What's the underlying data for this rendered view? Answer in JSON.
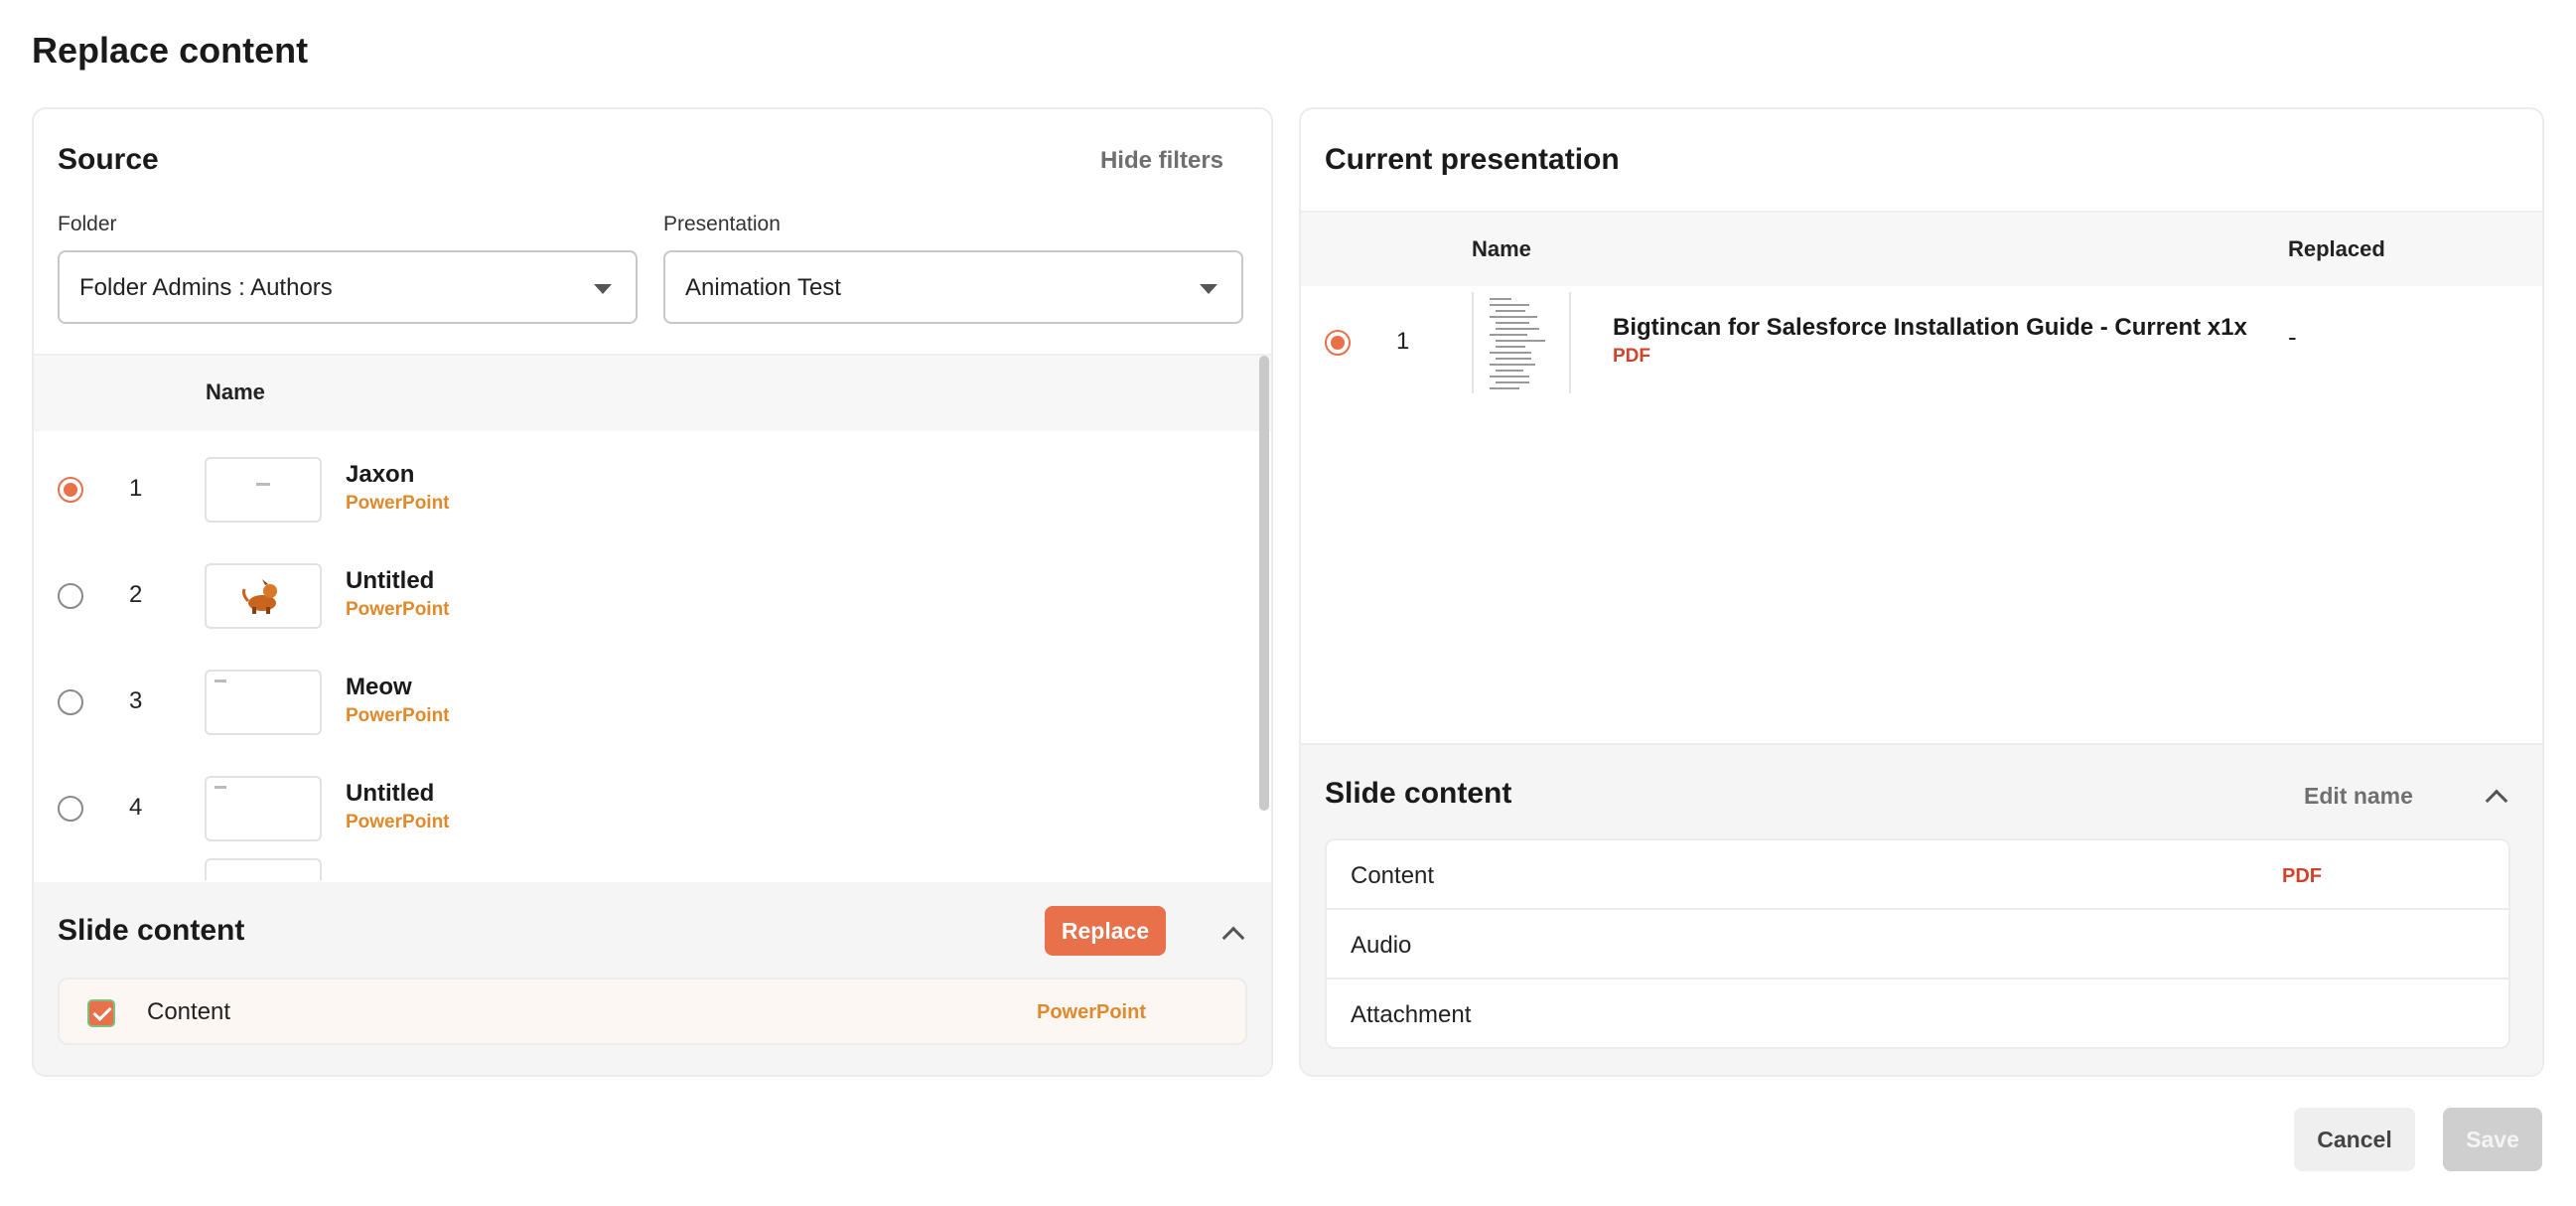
{
  "dialog": {
    "title": "Replace content"
  },
  "source": {
    "heading": "Source",
    "hide_filters_label": "Hide filters",
    "folder_label": "Folder",
    "folder_value": "Folder Admins : Authors",
    "presentation_label": "Presentation",
    "presentation_value": "Animation Test",
    "column_name": "Name",
    "items": [
      {
        "num": "1",
        "title": "Jaxon",
        "type": "PowerPoint",
        "selected": true
      },
      {
        "num": "2",
        "title": "Untitled",
        "type": "PowerPoint",
        "selected": false
      },
      {
        "num": "3",
        "title": "Meow",
        "type": "PowerPoint",
        "selected": false
      },
      {
        "num": "4",
        "title": "Untitled",
        "type": "PowerPoint",
        "selected": false
      }
    ],
    "slide_content": {
      "heading": "Slide content",
      "replace_label": "Replace",
      "content_label": "Content",
      "content_type": "PowerPoint",
      "checked": true
    }
  },
  "current": {
    "heading": "Current presentation",
    "column_name": "Name",
    "column_replaced": "Replaced",
    "row": {
      "num": "1",
      "title": "Bigtincan for Salesforce Installation Guide - Current x1x",
      "type": "PDF",
      "replaced": "-"
    },
    "slide_content": {
      "heading": "Slide content",
      "edit_name_label": "Edit name",
      "rows": [
        {
          "label": "Content",
          "value": "PDF"
        },
        {
          "label": "Audio",
          "value": ""
        },
        {
          "label": "Attachment",
          "value": ""
        }
      ]
    }
  },
  "footer": {
    "cancel_label": "Cancel",
    "save_label": "Save"
  },
  "colors": {
    "accent": "#e8704b",
    "powerpoint": "#e08a2c",
    "pdf": "#d0432b"
  }
}
